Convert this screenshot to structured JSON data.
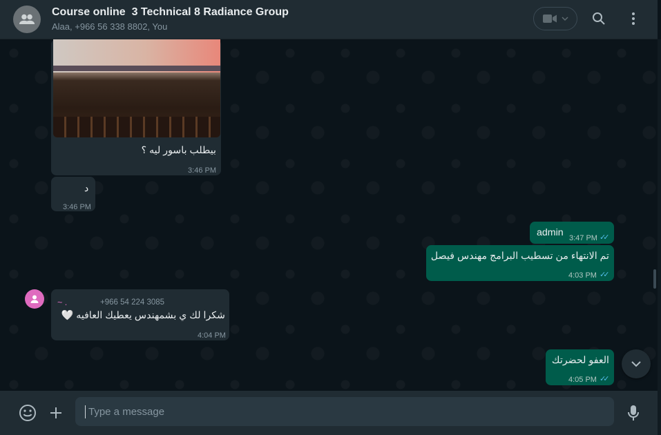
{
  "header": {
    "title": "Course online  3 Technical 8 Radiance Group",
    "subtitle": "Alaa, +966 56 338 8802, You"
  },
  "messages": [
    {
      "id": "photo_msg",
      "direction": "in",
      "text": "بيطلب باسور ليه ؟",
      "time": "3:46 PM"
    },
    {
      "id": "d_msg",
      "direction": "in",
      "text": "د",
      "time": "3:46 PM"
    },
    {
      "id": "admin_msg",
      "direction": "out",
      "text": "admin",
      "time": "3:47 PM",
      "status": "read"
    },
    {
      "id": "finish_msg",
      "direction": "out",
      "text": "تم الانتهاء من تسطيب البرامج مهندس فيصل",
      "time": "4:03 PM",
      "status": "read"
    },
    {
      "id": "thanks_msg",
      "direction": "in",
      "sender_name": "~ .",
      "sender_phone": "+966 54 224 3085",
      "text": "شكرا لك ي بشمهندس يعطيك العافيه 🤍",
      "time": "4:04 PM"
    },
    {
      "id": "welcome_msg",
      "direction": "out",
      "text": "العفو لحضرتك",
      "time": "4:05 PM",
      "status": "read"
    }
  ],
  "composer": {
    "placeholder": "Type a message"
  },
  "icons": {
    "group_avatar": "group-icon",
    "video": "video-call-icon",
    "search": "search-icon",
    "menu": "kebab-menu-icon",
    "emoji": "emoji-icon",
    "attach": "plus-icon",
    "mic": "microphone-icon",
    "scroll_down": "chevron-down-icon",
    "read_ticks": "double-check-icon"
  },
  "colors": {
    "header_bg": "#202c33",
    "chat_bg": "#0b141a",
    "incoming_bubble": "#202c33",
    "outgoing_bubble": "#005c4b",
    "read_tick": "#53bdeb",
    "sender_avatar": "#df6bbf"
  }
}
